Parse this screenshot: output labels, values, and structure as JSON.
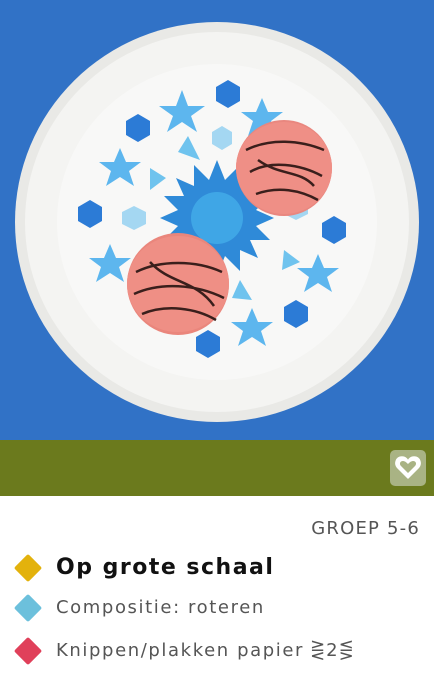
{
  "card": {
    "group_label": "GROEP 5-6",
    "title": "Op grote schaal",
    "tags": [
      {
        "label": "Compositie: roteren",
        "color": "#6cc0dc"
      },
      {
        "label": "Knippen/plakken papier",
        "color": "#e0405a"
      }
    ],
    "title_color": "#e3b20c",
    "tag_suffix": "⋛2⋚"
  },
  "photo": {
    "icon": "photo-plate-with-cakes",
    "alt": ""
  },
  "bar": {
    "color": "#6b7a1d",
    "favorite_icon": "heart-icon"
  }
}
